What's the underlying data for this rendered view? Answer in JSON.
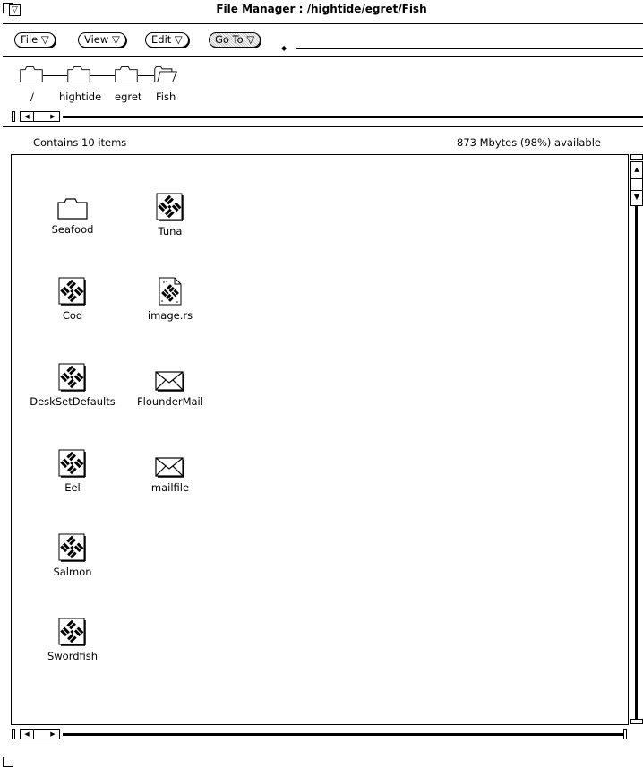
{
  "window": {
    "title": "File Manager : /hightide/egret/Fish"
  },
  "menubar": {
    "file": "File ▽",
    "view": "View ▽",
    "edit": "Edit ▽",
    "goto": "Go To ▽"
  },
  "path": {
    "segments": [
      "/",
      "hightide",
      "egret",
      "Fish"
    ]
  },
  "status": {
    "count": "Contains 10 items",
    "space": "873 Mbytes (98%) available"
  },
  "files": [
    {
      "name": "Seafood",
      "icon": "folder-icon"
    },
    {
      "name": "Tuna",
      "icon": "sun-document-icon"
    },
    {
      "name": "Cod",
      "icon": "sun-document-icon"
    },
    {
      "name": "image.rs",
      "icon": "raster-image-icon"
    },
    {
      "name": "DeskSetDefaults",
      "icon": "sun-document-icon"
    },
    {
      "name": "FlounderMail",
      "icon": "mail-envelope-icon"
    },
    {
      "name": "Eel",
      "icon": "sun-document-icon"
    },
    {
      "name": "mailfile",
      "icon": "mail-envelope-icon"
    },
    {
      "name": "Salmon",
      "icon": "sun-document-icon"
    },
    {
      "name": "Swordfish",
      "icon": "sun-document-icon"
    }
  ]
}
